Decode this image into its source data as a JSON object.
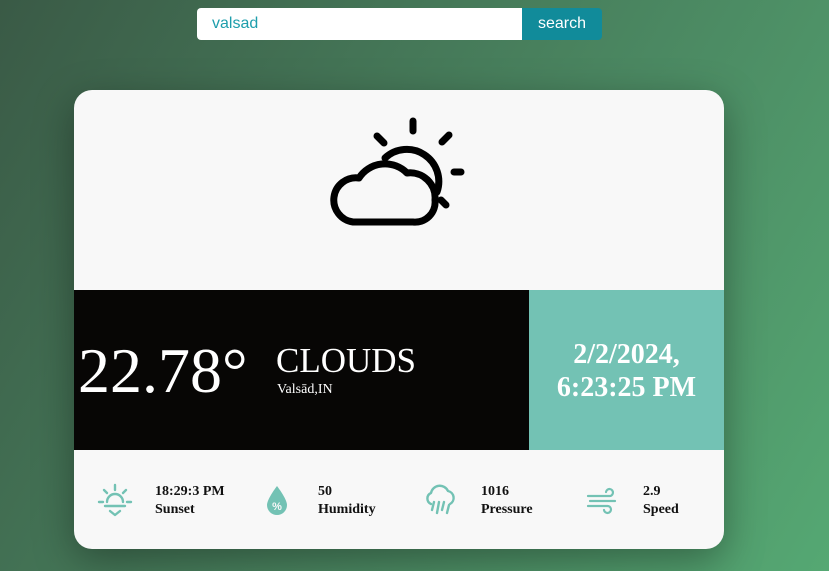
{
  "search": {
    "value": "valsad",
    "button_label": "search"
  },
  "weather": {
    "icon": "partly-cloudy-icon",
    "temperature": "22.78°",
    "condition": "CLOUDS",
    "location": "Valsād,IN",
    "date": "2/2/2024,",
    "time": "6:23:25 PM"
  },
  "stats": [
    {
      "icon": "sunset-icon",
      "value": "18:29:3 PM",
      "label": "Sunset"
    },
    {
      "icon": "humidity-icon",
      "value": "50",
      "label": "Humidity"
    },
    {
      "icon": "pressure-rain-icon",
      "value": "1016",
      "label": "Pressure"
    },
    {
      "icon": "wind-icon",
      "value": "2.9",
      "label": "Speed"
    }
  ],
  "colors": {
    "accent_teal": "#73c2b4",
    "search_button": "#118b9a",
    "dark_band": "#070605"
  }
}
